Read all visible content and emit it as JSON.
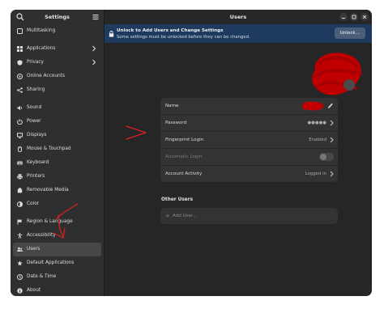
{
  "sidebar": {
    "title": "Settings",
    "items": [
      {
        "label": "Multitasking",
        "icon": "multitasking-icon"
      },
      {
        "label": "Applications",
        "icon": "applications-icon",
        "chevron": true
      },
      {
        "label": "Privacy",
        "icon": "privacy-icon",
        "chevron": true
      },
      {
        "label": "Online Accounts",
        "icon": "online-accounts-icon"
      },
      {
        "label": "Sharing",
        "icon": "sharing-icon"
      },
      {
        "label": "Sound",
        "icon": "sound-icon"
      },
      {
        "label": "Power",
        "icon": "power-icon"
      },
      {
        "label": "Displays",
        "icon": "displays-icon"
      },
      {
        "label": "Mouse & Touchpad",
        "icon": "mouse-icon"
      },
      {
        "label": "Keyboard",
        "icon": "keyboard-icon"
      },
      {
        "label": "Printers",
        "icon": "printer-icon"
      },
      {
        "label": "Removable Media",
        "icon": "removable-media-icon"
      },
      {
        "label": "Color",
        "icon": "color-icon"
      },
      {
        "label": "Region & Language",
        "icon": "region-flag-icon"
      },
      {
        "label": "Accessibility",
        "icon": "accessibility-icon"
      },
      {
        "label": "Users",
        "icon": "users-icon"
      },
      {
        "label": "Default Applications",
        "icon": "default-apps-icon"
      },
      {
        "label": "Date & Time",
        "icon": "clock-icon"
      },
      {
        "label": "About",
        "icon": "info-icon"
      }
    ]
  },
  "main": {
    "title": "Users",
    "banner": {
      "title": "Unlock to Add Users and Change Settings",
      "subtitle": "Some settings must be unlocked before they can be changed.",
      "button": "Unlock…"
    },
    "rows": [
      {
        "label": "Name"
      },
      {
        "label": "Password",
        "value": "●●●●●"
      },
      {
        "label": "Fingerprint Login",
        "value": "Enabled"
      },
      {
        "label": "Automatic Login",
        "toggle": false
      },
      {
        "label": "Account Activity",
        "value": "Logged in"
      }
    ],
    "other_users": {
      "heading": "Other Users",
      "add_label": "Add User…"
    }
  },
  "colors": {
    "banner": "#1e3a5e",
    "annotation": "#e02020",
    "redaction": "#c00000"
  }
}
